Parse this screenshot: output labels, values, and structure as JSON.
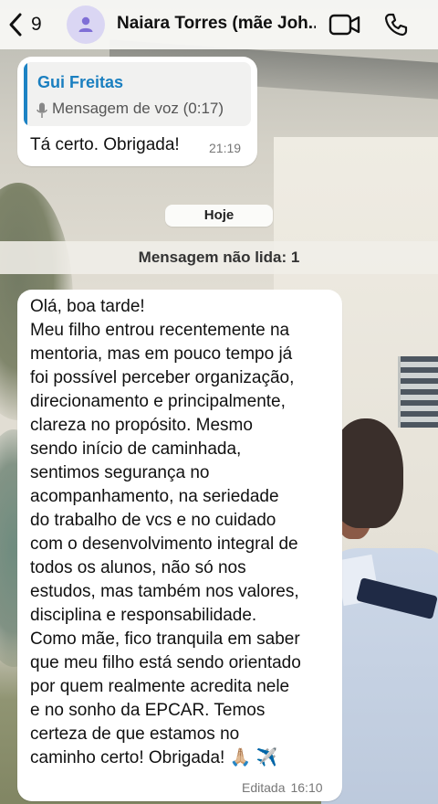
{
  "header": {
    "back_count": "9",
    "contact_name": "Naiara Torres (mãe Joh...",
    "icons": [
      "chevron-left-icon",
      "person-icon",
      "video-camera-icon",
      "phone-icon"
    ]
  },
  "messages": {
    "quoted": {
      "author": "Gui Freitas",
      "text": "Mensagem de voz (0:17)",
      "icon": "mic-icon"
    },
    "first": {
      "text": "Tá certo. Obrigada!",
      "time": "21:19"
    },
    "day_separator": "Hoje",
    "unread_banner": "Mensagem não lida: 1",
    "second": {
      "lines": [
        "Olá, boa tarde!",
        "Meu filho entrou recentemente na",
        "mentoria, mas em pouco tempo já",
        "foi possível perceber organização,",
        "direcionamento e principalmente,",
        "clareza no propósito. Mesmo",
        "sendo início de caminhada,",
        "sentimos segurança no",
        "acompanhamento, na seriedade",
        "do trabalho de vcs e no cuidado",
        "com o desenvolvimento integral de",
        "todos os alunos, não só nos",
        "estudos, mas também nos valores,",
        "disciplina e responsabilidade.",
        "Como mãe, fico tranquila em saber",
        "que meu filho está sendo orientado",
        "por quem realmente acredita nele",
        "e no sonho da EPCAR. Temos",
        "certeza de que estamos no",
        "caminho certo! Obrigada! 🙏🏼 ✈️"
      ],
      "edited_label": "Editada",
      "time": "16:10"
    }
  },
  "colors": {
    "accent": "#1a7fc0",
    "bubble": "#ffffff",
    "header_bg": "#f7f7f5",
    "avatar_bg": "#dad6f3",
    "avatar_icon": "#7f6fd6"
  }
}
